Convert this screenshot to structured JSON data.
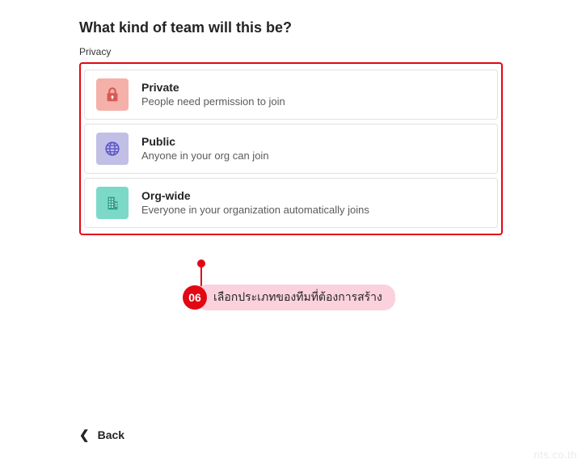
{
  "title": "What kind of team will this be?",
  "section_label": "Privacy",
  "options": [
    {
      "title": "Private",
      "desc": "People need permission to join"
    },
    {
      "title": "Public",
      "desc": "Anyone in your org can join"
    },
    {
      "title": "Org-wide",
      "desc": "Everyone in your organization automatically joins"
    }
  ],
  "callout": {
    "number": "06",
    "text": "เลือกประเภทของทีมที่ต้องการสร้าง"
  },
  "back_label": "Back",
  "watermark": "nts.co.th",
  "colors": {
    "highlight": "#e30613",
    "pill_bg": "#fbd1dd",
    "icon_private_bg": "#f5b0aa",
    "icon_public_bg": "#c1bfe6",
    "icon_org_bg": "#7cd9c8"
  }
}
